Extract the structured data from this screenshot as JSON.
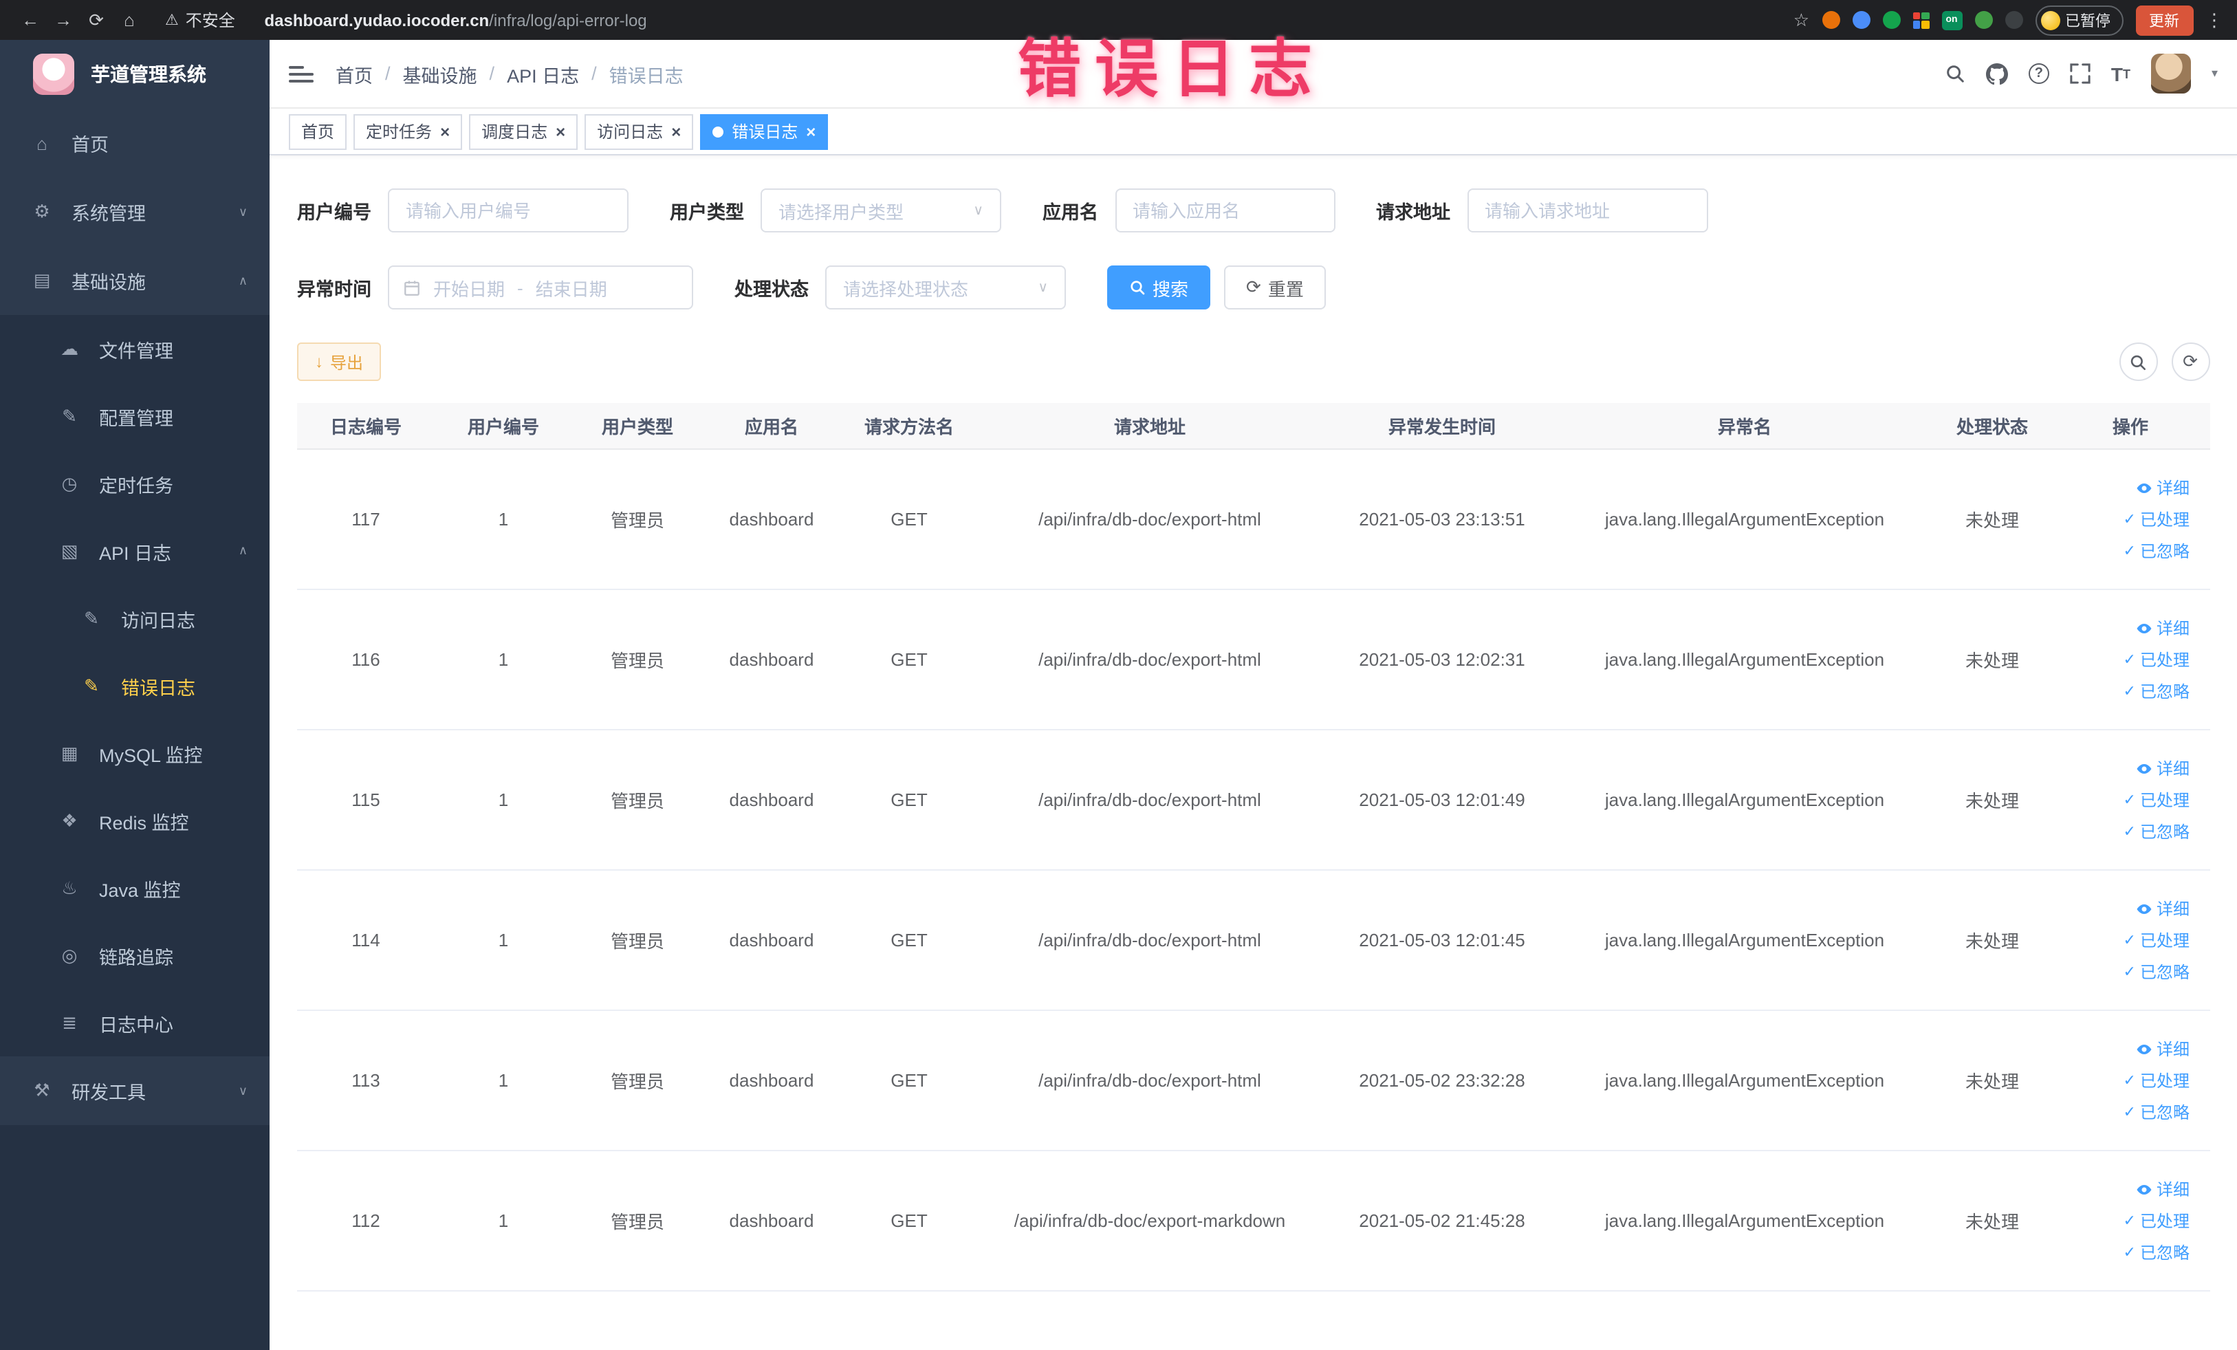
{
  "annotation": {
    "text": "错误日志"
  },
  "browser": {
    "security_label": "不安全",
    "url_domain": "dashboard.yudao.iocoder.cn",
    "url_path": "/infra/log/api-error-log",
    "on_badge": "on",
    "paused_label": "已暂停",
    "update_label": "更新"
  },
  "glyphs": {
    "back": "←",
    "forward": "→",
    "reload": "⟳",
    "home": "⌂",
    "warning": "⚠",
    "star": "☆",
    "kebab": "⋮",
    "breadcrumb_sep": "/",
    "caret_down": "▾",
    "close": "×",
    "check": "✓",
    "select_arrow": "∨",
    "date_dash": "-",
    "download": "↓",
    "refresh": "⟳",
    "help": "?",
    "font_big": "T",
    "font_small": "T"
  },
  "sidebar": {
    "logo_title": "芋道管理系统",
    "top_items": [
      {
        "icon": "⌂",
        "label": "首页"
      },
      {
        "icon": "⚙",
        "label": "系统管理",
        "arrow": "∨"
      },
      {
        "icon": "▤",
        "label": "基础设施",
        "arrow": "∧"
      }
    ],
    "infra_submenu": [
      {
        "icon": "☁",
        "label": "文件管理"
      },
      {
        "icon": "✎",
        "label": "配置管理"
      },
      {
        "icon": "◷",
        "label": "定时任务"
      },
      {
        "icon": "▧",
        "label": "API 日志",
        "arrow": "∧"
      }
    ],
    "api_submenu": [
      {
        "icon": "✎",
        "label": "访问日志"
      },
      {
        "icon": "✎",
        "label": "错误日志",
        "active": true
      }
    ],
    "infra_submenu_rest": [
      {
        "icon": "▦",
        "label": "MySQL 监控"
      },
      {
        "icon": "❖",
        "label": "Redis 监控"
      },
      {
        "icon": "♨",
        "label": "Java 监控"
      },
      {
        "icon": "◎",
        "label": "链路追踪"
      },
      {
        "icon": "≣",
        "label": "日志中心"
      }
    ],
    "bottom_items": [
      {
        "icon": "⚒",
        "label": "研发工具",
        "arrow": "∨"
      }
    ]
  },
  "header": {
    "breadcrumb": [
      "首页",
      "基础设施",
      "API 日志",
      "错误日志"
    ]
  },
  "tabs": [
    {
      "label": "首页",
      "closable": false,
      "active": false
    },
    {
      "label": "定时任务",
      "closable": true,
      "active": false
    },
    {
      "label": "调度日志",
      "closable": true,
      "active": false
    },
    {
      "label": "访问日志",
      "closable": true,
      "active": false
    },
    {
      "label": "错误日志",
      "closable": true,
      "active": true
    }
  ],
  "filters": {
    "user_id": {
      "label": "用户编号",
      "placeholder": "请输入用户编号"
    },
    "user_type": {
      "label": "用户类型",
      "placeholder": "请选择用户类型"
    },
    "app_name": {
      "label": "应用名",
      "placeholder": "请输入应用名"
    },
    "request_url": {
      "label": "请求地址",
      "placeholder": "请输入请求地址"
    },
    "exception_time": {
      "label": "异常时间",
      "start_placeholder": "开始日期",
      "end_placeholder": "结束日期"
    },
    "process_status": {
      "label": "处理状态",
      "placeholder": "请选择处理状态"
    },
    "search_button": "搜索",
    "reset_button": "重置"
  },
  "toolbar": {
    "export_label": "导出"
  },
  "table": {
    "columns": [
      "日志编号",
      "用户编号",
      "用户类型",
      "应用名",
      "请求方法名",
      "请求地址",
      "异常发生时间",
      "异常名",
      "处理状态",
      "操作"
    ],
    "action_labels": {
      "detail": "详细",
      "processed": "已处理",
      "ignored": "已忽略"
    },
    "rows": [
      {
        "id": "117",
        "user_id": "1",
        "user_type": "管理员",
        "app": "dashboard",
        "method": "GET",
        "url": "/api/infra/db-doc/export-html",
        "time": "2021-05-03 23:13:51",
        "exception": "java.lang.IllegalArgumentException",
        "status": "未处理"
      },
      {
        "id": "116",
        "user_id": "1",
        "user_type": "管理员",
        "app": "dashboard",
        "method": "GET",
        "url": "/api/infra/db-doc/export-html",
        "time": "2021-05-03 12:02:31",
        "exception": "java.lang.IllegalArgumentException",
        "status": "未处理"
      },
      {
        "id": "115",
        "user_id": "1",
        "user_type": "管理员",
        "app": "dashboard",
        "method": "GET",
        "url": "/api/infra/db-doc/export-html",
        "time": "2021-05-03 12:01:49",
        "exception": "java.lang.IllegalArgumentException",
        "status": "未处理"
      },
      {
        "id": "114",
        "user_id": "1",
        "user_type": "管理员",
        "app": "dashboard",
        "method": "GET",
        "url": "/api/infra/db-doc/export-html",
        "time": "2021-05-03 12:01:45",
        "exception": "java.lang.IllegalArgumentException",
        "status": "未处理"
      },
      {
        "id": "113",
        "user_id": "1",
        "user_type": "管理员",
        "app": "dashboard",
        "method": "GET",
        "url": "/api/infra/db-doc/export-html",
        "time": "2021-05-02 23:32:28",
        "exception": "java.lang.IllegalArgumentException",
        "status": "未处理"
      },
      {
        "id": "112",
        "user_id": "1",
        "user_type": "管理员",
        "app": "dashboard",
        "method": "GET",
        "url": "/api/infra/db-doc/export-markdown",
        "time": "2021-05-02 21:45:28",
        "exception": "java.lang.IllegalArgumentException",
        "status": "未处理"
      }
    ]
  }
}
